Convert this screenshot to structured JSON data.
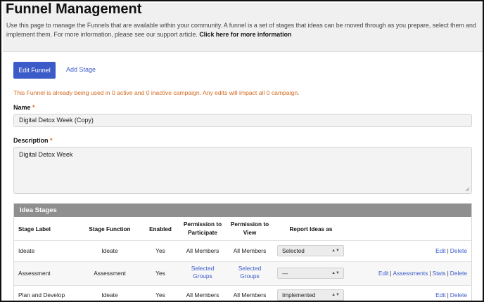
{
  "header": {
    "title": "Funnel Management",
    "intro": "Use this page to manage the Funnels that are available within your community. A funnel is a set of stages that ideas can be moved through as you prepare, select them and implement them. For more information, please see our support article.",
    "more_link": "Click here for more information"
  },
  "toolbar": {
    "edit_funnel": "Edit Funnel",
    "add_stage": "Add Stage"
  },
  "warning": "This Funnel is already being used in 0 active and 0 inactive campaign. Any edits will impact all 0 campaign.",
  "form": {
    "name_label": "Name",
    "name_value": "Digital Detox Week (Copy)",
    "description_label": "Description",
    "description_value": "Digital Detox Week",
    "required_mark": "*"
  },
  "stages": {
    "title": "Idea Stages",
    "columns": {
      "stage_label": "Stage Label",
      "stage_function": "Stage Function",
      "enabled": "Enabled",
      "perm_participate_1": "Permission to",
      "perm_participate_2": "Participate",
      "perm_view_1": "Permission to",
      "perm_view_2": "View",
      "report_ideas": "Report Ideas as"
    },
    "rows": [
      {
        "label": "Ideate",
        "function": "Ideate",
        "enabled": "Yes",
        "participate": "All Members",
        "view": "All Members",
        "report": "Selected",
        "actions": [
          "Edit",
          "Delete"
        ]
      },
      {
        "label": "Assessment",
        "function": "Assessment",
        "enabled": "Yes",
        "participate_1": "Selected",
        "participate_2": "Groups",
        "view_1": "Selected",
        "view_2": "Groups",
        "report": "---",
        "actions": [
          "Edit",
          "Assessments",
          "Stats",
          "Delete"
        ]
      },
      {
        "label": "Plan and Develop",
        "function": "Ideate",
        "enabled": "Yes",
        "participate": "All Members",
        "view": "All Members",
        "report": "Implemented",
        "actions": [
          "Edit",
          "Delete"
        ]
      }
    ]
  }
}
